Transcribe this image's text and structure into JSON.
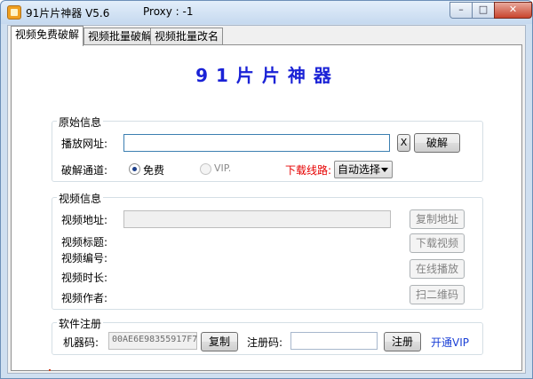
{
  "window": {
    "title": "91片片神器 V5.6",
    "proxy": "Proxy : -1",
    "minimize_glyph": "–",
    "maximize_glyph": "□",
    "close_glyph": "✕"
  },
  "tabs": [
    {
      "label": "视频免费破解",
      "active": true
    },
    {
      "label": "视频批量破解",
      "active": false
    },
    {
      "label": "视频批量改名",
      "active": false
    }
  ],
  "heading": "91片片神器",
  "original_info": {
    "group_title": "原始信息",
    "url_label": "播放网址:",
    "url_value": "",
    "clear_label": "X",
    "crack_label": "破解",
    "channel_label": "破解通道:",
    "option_free": "免费",
    "option_vip": "VIP.",
    "selected_option": "免费",
    "download_route_label": "下载线路:",
    "download_route_value": "自动选择"
  },
  "video_info": {
    "group_title": "视频信息",
    "address_label": "视频地址:",
    "address_value": "",
    "title_label": "视频标题:",
    "number_label": "视频编号:",
    "duration_label": "视频时长:",
    "author_label": "视频作者:",
    "copy_address_label": "复制地址",
    "download_video_label": "下载视频",
    "online_play_label": "在线播放",
    "scan_qr_label": "扫二维码"
  },
  "registration": {
    "group_title": "软件注册",
    "machine_code_label": "机器码:",
    "machine_code_value": "00AE6E98355917F7",
    "copy_label": "复制",
    "reg_code_label": "注册码:",
    "reg_code_value": "",
    "register_label": "注册",
    "open_vip_label": "开通VIP"
  },
  "colors": {
    "heading": "#1a22d6",
    "download_route": "#e60000",
    "vip_link": "#1a3fd6"
  }
}
